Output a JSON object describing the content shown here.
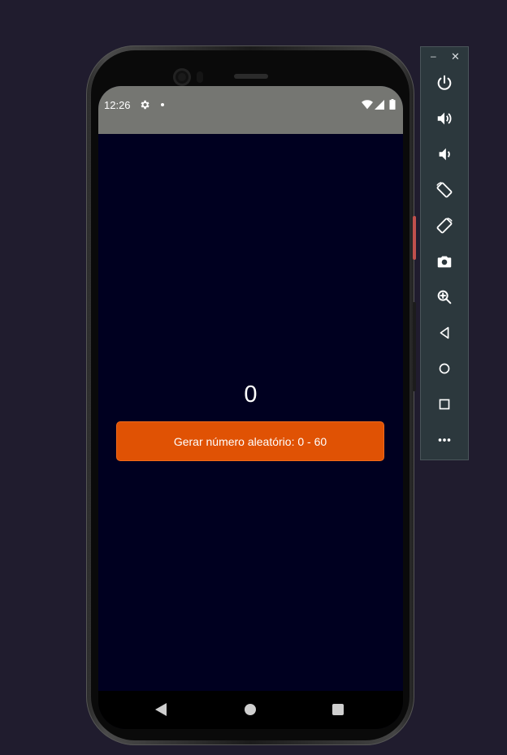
{
  "status_bar": {
    "time": "12:26",
    "icons": [
      "gear-icon",
      "notification-dot",
      "wifi-icon",
      "signal-icon",
      "battery-icon"
    ]
  },
  "app": {
    "counter_value": "0",
    "generate_button_label": "Gerar número aleatório: 0 - 60",
    "background_color": "#000020",
    "button_color": "#e05204"
  },
  "nav_bar": {
    "buttons": [
      "back-icon",
      "home-icon",
      "recents-icon"
    ]
  },
  "emulator_toolbar": {
    "minimize_label": "–",
    "close_label": "✕",
    "buttons": [
      "power-icon",
      "volume-up-icon",
      "volume-down-icon",
      "rotate-left-icon",
      "rotate-right-icon",
      "camera-icon",
      "zoom-icon",
      "back-icon",
      "home-icon",
      "overview-icon",
      "more-icon"
    ]
  }
}
